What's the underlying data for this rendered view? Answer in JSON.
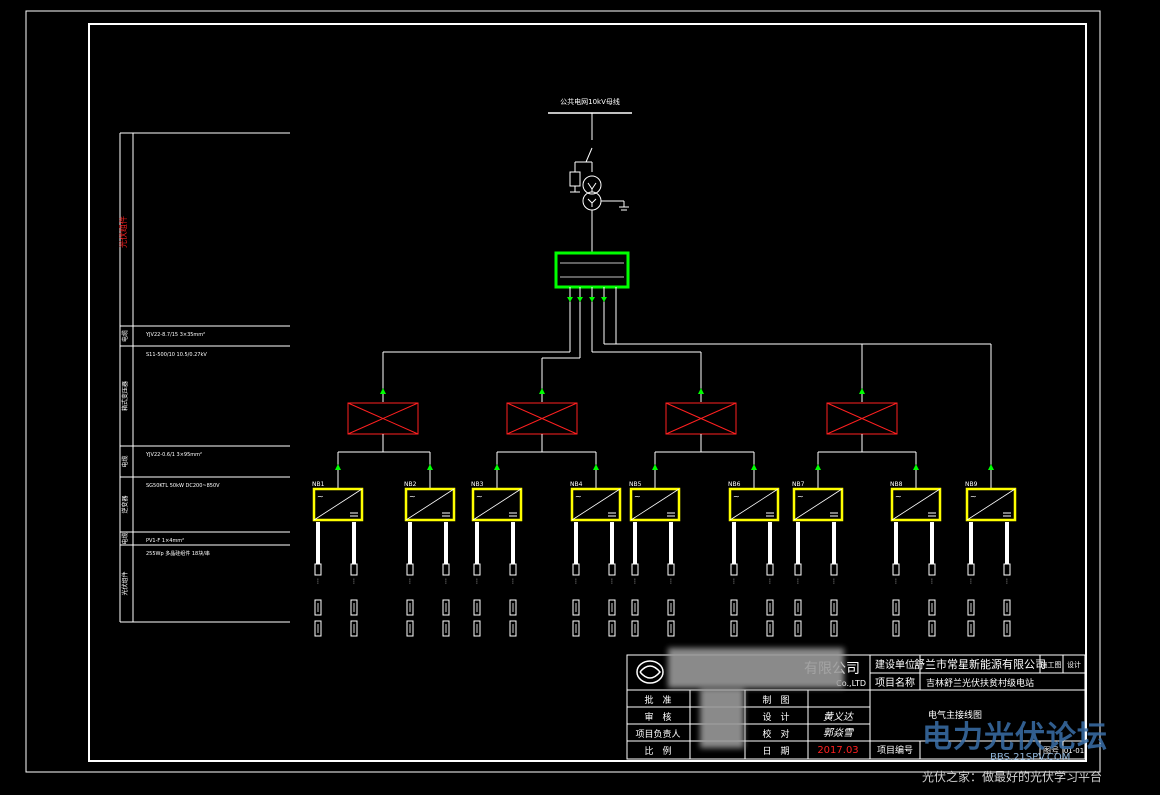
{
  "diagram": {
    "grid_label": "公共电网10kV母线",
    "inverters": [
      "NB1",
      "NB2",
      "NB3",
      "NB4",
      "NB5",
      "NB6",
      "NB7",
      "NB8",
      "NB9"
    ],
    "left_panel": {
      "vertical_header": "光伏组件",
      "row_labels": [
        "电缆",
        "箱式变压器",
        "电缆",
        "逆变器",
        "电缆",
        "光伏组件"
      ],
      "row_notes": [
        "YJV22-8.7/15 3×35mm²",
        "S11-500/10  10.5/0.27kV",
        "YJV22-0.6/1 3×95mm²",
        "SG50KTL 50kW  DC200~850V",
        "PV1-F 1×4mm²",
        "255Wp 多晶硅组件  18块/串"
      ]
    }
  },
  "title_block": {
    "company": "有限公司",
    "company_en": "Co.,LTD",
    "construction_unit_label": "建设单位",
    "construction_unit_value": "舒兰市常星新能源有限公司",
    "stage_label": "施工图",
    "stage_value": "设计",
    "project_name_label": "项目名称",
    "project_name_value": "吉林舒兰光伏扶贫村级电站",
    "drawing_title": "电气主接线图",
    "rows": [
      {
        "l1": "批　准",
        "l2": "制　图"
      },
      {
        "l1": "审　核",
        "l2": "设　计"
      },
      {
        "l1": "项目负责人",
        "l2": "校　对"
      },
      {
        "l1": "比　例",
        "l2": "日　期"
      }
    ],
    "date": "2017.03",
    "project_no_label": "项目编号",
    "drawing_no_label": "图号",
    "drawing_no_value": "01-01",
    "signature1": "黄义达",
    "signature2": "郭焱雪"
  },
  "watermark": {
    "brand": "电力光伏论坛",
    "site": "BBS.21SPV.COM",
    "slogan": "光伏之家：做最好的光伏学习平台"
  },
  "colors": {
    "background": "#000000",
    "line": "#ffffff",
    "combiner": "#ff2020",
    "cabinet": "#00ff00",
    "inverter": "#ffff00",
    "arrow": "#00ff00"
  }
}
